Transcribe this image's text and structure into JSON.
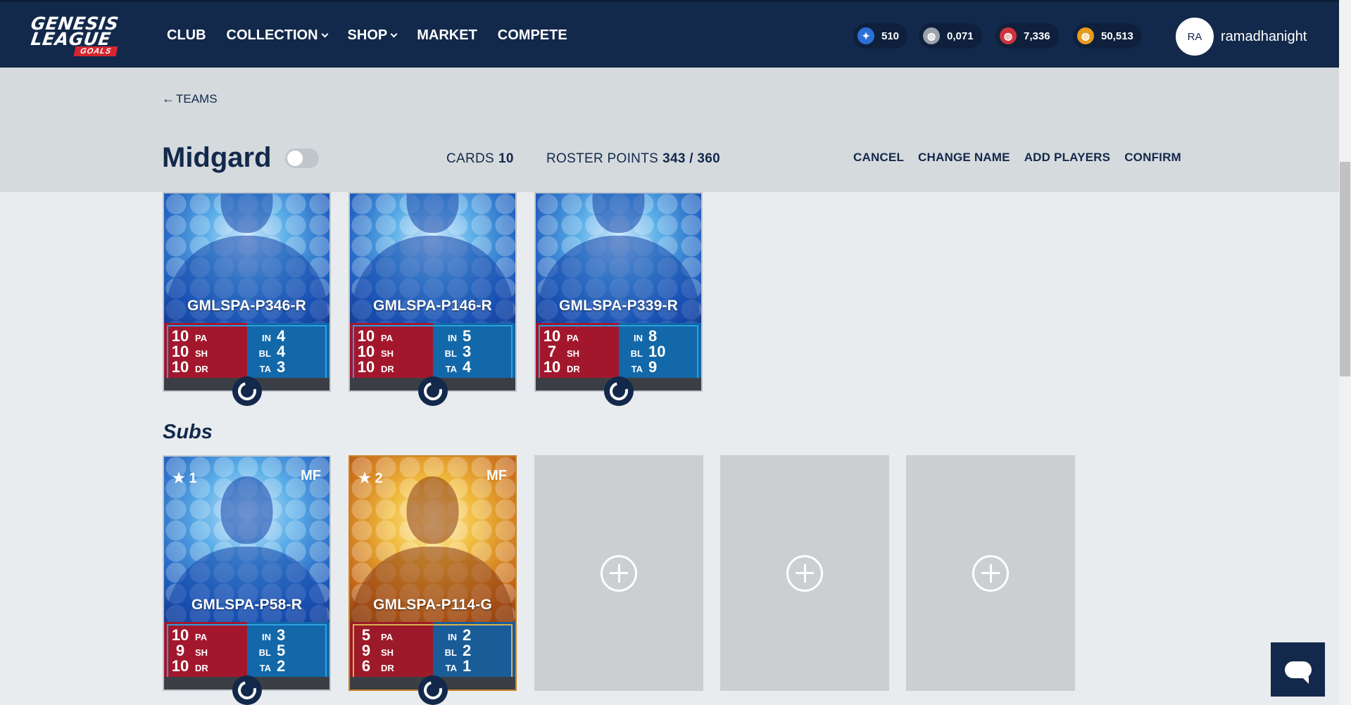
{
  "nav": {
    "logo_line1": "GENESIS",
    "logo_line2": "LEAGUE",
    "logo_line3": "GOALS",
    "links": [
      {
        "label": "CLUB",
        "dropdown": false
      },
      {
        "label": "COLLECTION",
        "dropdown": true
      },
      {
        "label": "SHOP",
        "dropdown": true
      },
      {
        "label": "MARKET",
        "dropdown": false
      },
      {
        "label": "COMPETE",
        "dropdown": false
      }
    ],
    "wallets": [
      {
        "value": "510",
        "icon": "star-coin-icon",
        "color": "#2b6fd6"
      },
      {
        "value": "0,071",
        "icon": "silver-ball-icon",
        "color": "#9aa3ad"
      },
      {
        "value": "7,336",
        "icon": "red-ball-icon",
        "color": "#d0333c"
      },
      {
        "value": "50,513",
        "icon": "gold-ball-icon",
        "color": "#e79b1b"
      }
    ],
    "avatar_initials": "RA",
    "username": "ramadhanight"
  },
  "team": {
    "back_label": "TEAMS",
    "name": "Midgard",
    "cards_label": "CARDS",
    "cards_value": "10",
    "roster_label": "ROSTER POINTS",
    "roster_value": "343 / 360",
    "actions": [
      "CANCEL",
      "CHANGE NAME",
      "ADD PLAYERS",
      "CONFIRM"
    ]
  },
  "starters": [
    {
      "name": "GMLSPA-P346-R",
      "pa": "10",
      "sh": "10",
      "dr": "10",
      "in": "4",
      "bl": "4",
      "ta": "3",
      "rarity": "blue"
    },
    {
      "name": "GMLSPA-P146-R",
      "pa": "10",
      "sh": "10",
      "dr": "10",
      "in": "5",
      "bl": "3",
      "ta": "4",
      "rarity": "blue"
    },
    {
      "name": "GMLSPA-P339-R",
      "pa": "10",
      "sh": "7",
      "dr": "10",
      "in": "8",
      "bl": "10",
      "ta": "9",
      "rarity": "blue"
    }
  ],
  "subs_title": "Subs",
  "subs": [
    {
      "name": "GMLSPA-P58-R",
      "stars": "1",
      "position": "MF",
      "pa": "10",
      "sh": "9",
      "dr": "10",
      "in": "3",
      "bl": "5",
      "ta": "2",
      "rarity": "blue"
    },
    {
      "name": "GMLSPA-P114-G",
      "stars": "2",
      "position": "MF",
      "pa": "5",
      "sh": "9",
      "dr": "6",
      "in": "2",
      "bl": "2",
      "ta": "1",
      "rarity": "gold"
    }
  ],
  "stat_keys": {
    "pa": "PA",
    "sh": "SH",
    "dr": "DR",
    "in": "IN",
    "bl": "BL",
    "ta": "TA"
  },
  "star_glyph": "★",
  "empty_slots": 3
}
